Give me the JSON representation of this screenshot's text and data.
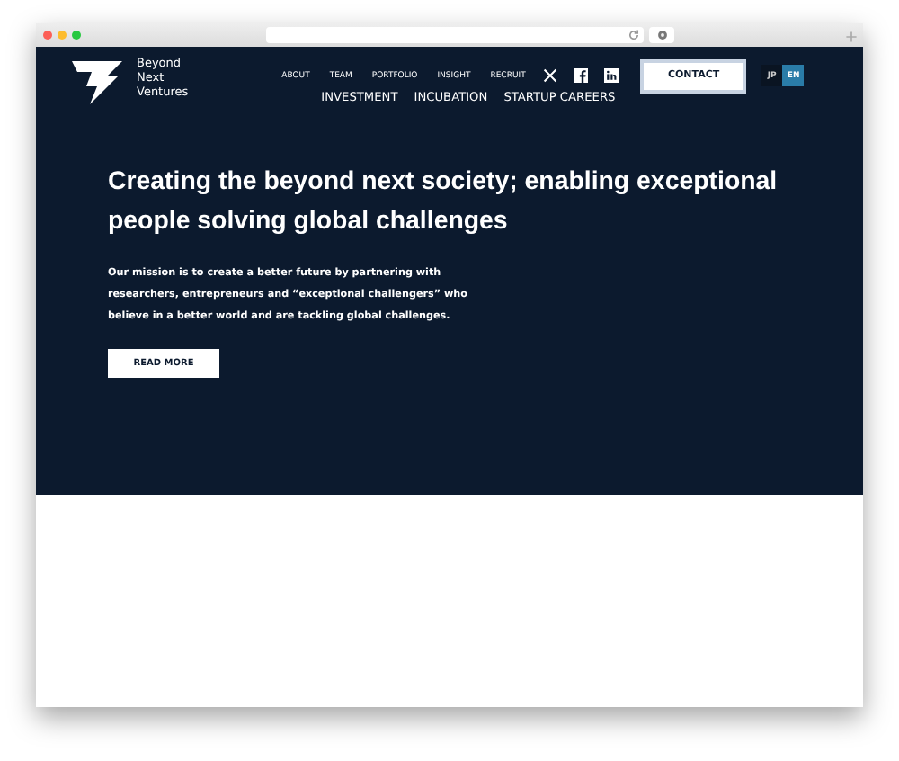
{
  "brand": {
    "name_lines": [
      "Beyond",
      "Next",
      "Ventures"
    ]
  },
  "top_nav": [
    "ABOUT",
    "TEAM",
    "PORTFOLIO",
    "INSIGHT",
    "RECRUIT"
  ],
  "contact_button": "CONTACT",
  "languages": [
    {
      "label": "JP",
      "selected": false
    },
    {
      "label": "EN",
      "selected": true
    }
  ],
  "main_nav": [
    "INVESTMENT",
    "INCUBATION",
    "STARTUP CAREERS"
  ],
  "hero": {
    "headline": "Creating the beyond next society; enabling exceptional people solving global challenges",
    "mission": "Our mission is to create a better future by partnering with researchers, entrepreneurs and “exceptional challengers” who believe in a better world and are tackling global challenges.",
    "button": "READ MORE"
  }
}
